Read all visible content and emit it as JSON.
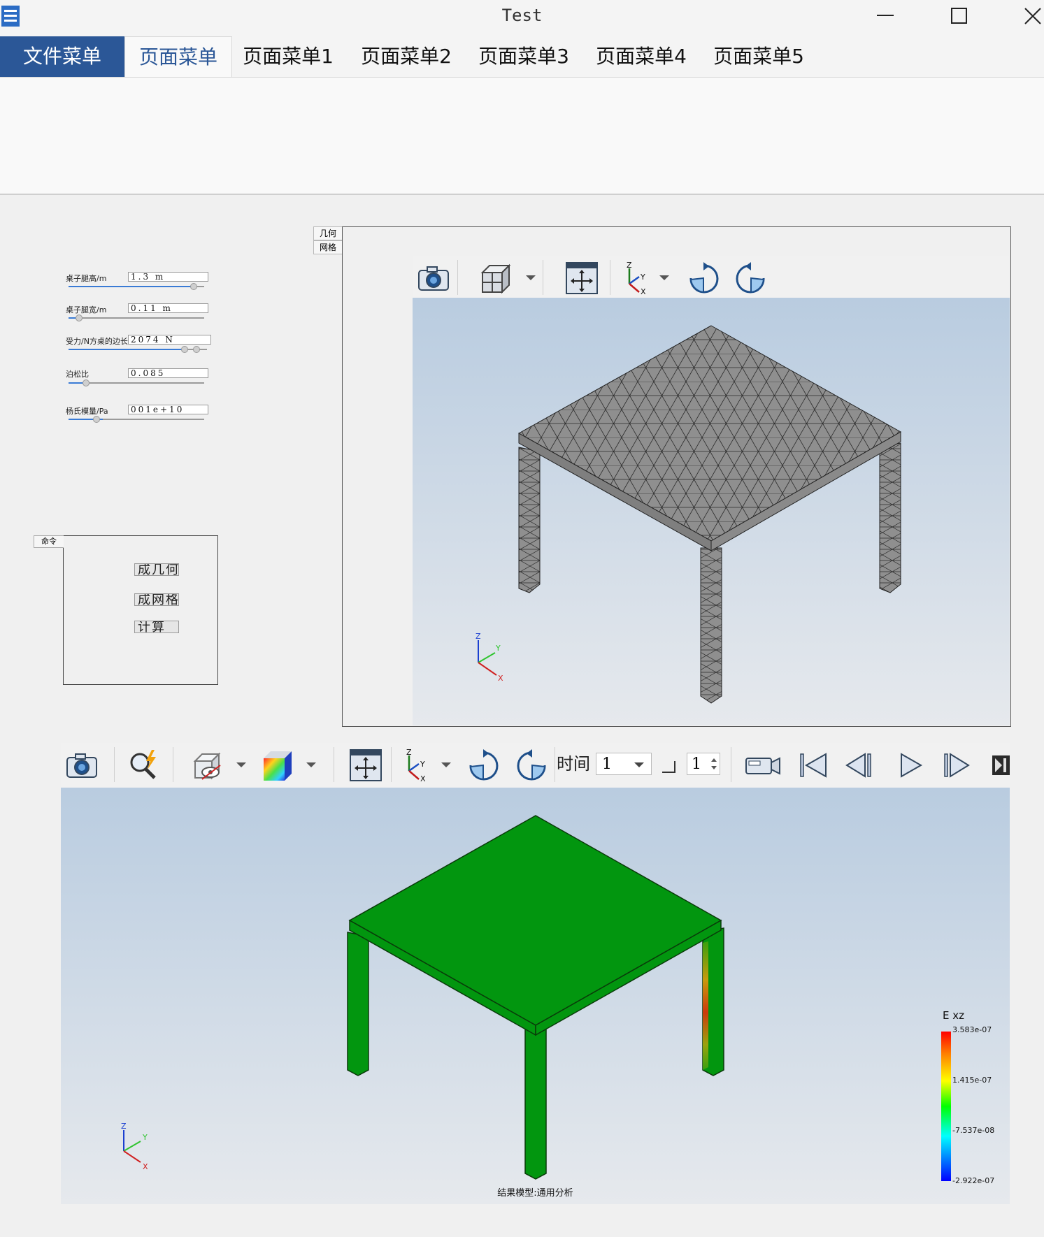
{
  "window": {
    "title": "Test"
  },
  "ribbon": {
    "tabs": [
      "文件菜单",
      "页面菜单",
      "页面菜单1",
      "页面菜单2",
      "页面菜单3",
      "页面菜单4",
      "页面菜单5"
    ]
  },
  "params": [
    {
      "label": "桌子腿高/m",
      "value": "1.3 m",
      "slider": 0.92
    },
    {
      "label": "桌子腿宽/m",
      "value": "0.11 m",
      "slider": 0.08
    },
    {
      "label": "受力/N方桌的边长",
      "value": "2074 N",
      "slider": 0.85
    },
    {
      "label": "泊松比",
      "value": "0.085",
      "slider": 0.15
    },
    {
      "label": "杨氏模量/Pa",
      "value": "001e+10",
      "slider": 0.25
    }
  ],
  "commands": {
    "title": "命令",
    "buttons": [
      "成几何",
      "成网格",
      "计算"
    ]
  },
  "viewer_tabs": [
    "几何",
    "网格"
  ],
  "result_toolbar": {
    "time_label": "时间",
    "time_value": "1",
    "step_value": "1"
  },
  "result_view": {
    "caption": "结果模型:通用分析",
    "legend": {
      "title": "E xz",
      "labels": [
        "3.583e-07",
        "1.415e-07",
        "-7.537e-08",
        "-2.922e-07"
      ]
    }
  },
  "axes": {
    "x": "X",
    "y": "Y",
    "z": "Z"
  },
  "colors": {
    "accent": "#2b5797",
    "mesh_gray": "#8c8c8c",
    "result_green": "#02960f"
  },
  "icons": [
    "app-icon",
    "minimize-icon",
    "maximize-icon",
    "close-icon",
    "camera-icon",
    "cube-view-icon",
    "fit-view-icon",
    "axes-view-icon",
    "rotate-cw-icon",
    "rotate-ccw-icon",
    "probe-icon",
    "hide-surface-icon",
    "color-map-icon",
    "video-icon",
    "first-frame-icon",
    "prev-frame-icon",
    "play-icon",
    "next-frame-icon",
    "last-frame-icon"
  ]
}
